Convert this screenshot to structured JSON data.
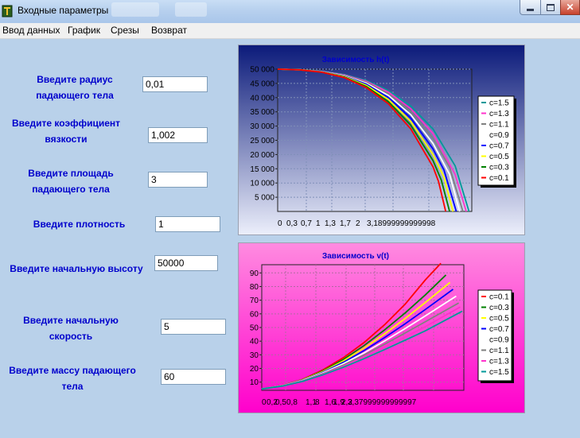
{
  "window": {
    "title": "Входные параметры"
  },
  "menu": {
    "items": [
      "Ввод данных",
      "График",
      "Срезы",
      "Возврат"
    ]
  },
  "form": {
    "radius_label": "Введите радиус падающего тела",
    "radius_value": "0,01",
    "viscosity_label": "Введите коэффициент вязкости",
    "viscosity_value": "1,002",
    "area_label": "Введите площадь падающего тела",
    "area_value": "3",
    "density_label": "Введите плотность",
    "density_value": "1",
    "height_label": "Введите начальную высоту",
    "height_value": "50000",
    "speed_label": "Введите начальную скорость",
    "speed_value": "5",
    "mass_label": "Введите массу падающего тела",
    "mass_value": "60"
  },
  "colors": {
    "window_bg": "#b9d1ea",
    "label_text": "#0000cc",
    "chart1_top": "#0b1a7a",
    "chart2_bg": "#ff33cc"
  },
  "chart_data": [
    {
      "type": "line",
      "title": "Зависимость h(t)",
      "x_tick_labels": [
        "0",
        "0,3",
        "0,7",
        "1",
        "1,3",
        "1,7",
        "2",
        "3,18999999999998"
      ],
      "y_ticks": [
        5000,
        10000,
        15000,
        20000,
        25000,
        30000,
        35000,
        40000,
        45000,
        50000
      ],
      "y_tick_labels": [
        "5 000",
        "10 000",
        "15 000",
        "20 000",
        "25 000",
        "30 000",
        "35 000",
        "40 000",
        "45 000",
        "50 000"
      ],
      "ylim": [
        0,
        50000
      ],
      "grid": true,
      "legend_position": "right",
      "series": [
        {
          "name": "c=1.5",
          "color": "#009999",
          "x": [
            0,
            0.4,
            0.8,
            1.2,
            1.6,
            2.0,
            2.4,
            2.8,
            3.2,
            3.45
          ],
          "y": [
            50000,
            49820,
            49250,
            48100,
            46000,
            42400,
            37000,
            29000,
            16000,
            0
          ]
        },
        {
          "name": "c=1.3",
          "color": "#ff33cc",
          "x": [
            0,
            0.4,
            0.8,
            1.2,
            1.6,
            2.0,
            2.4,
            2.8,
            3.2,
            3.4
          ],
          "y": [
            50000,
            49810,
            49200,
            48000,
            45700,
            41900,
            36100,
            27400,
            13000,
            0
          ]
        },
        {
          "name": "c=1.1",
          "color": "#808080",
          "x": [
            0,
            0.4,
            0.8,
            1.2,
            1.6,
            2.0,
            2.4,
            2.8,
            3.1,
            3.34
          ],
          "y": [
            50000,
            49800,
            49150,
            47850,
            45400,
            41300,
            35100,
            25700,
            15500,
            0
          ]
        },
        {
          "name": "c=0.9",
          "color": "#ffffff",
          "x": [
            0,
            0.4,
            0.8,
            1.2,
            1.6,
            2.0,
            2.4,
            2.8,
            3.1,
            3.28
          ],
          "y": [
            50000,
            49790,
            49100,
            47700,
            45050,
            40700,
            34000,
            23900,
            13000,
            0
          ]
        },
        {
          "name": "c=0.7",
          "color": "#0000ff",
          "x": [
            0,
            0.4,
            0.8,
            1.2,
            1.6,
            2.0,
            2.4,
            2.8,
            3.0,
            3.22
          ],
          "y": [
            50000,
            49780,
            49050,
            47550,
            44700,
            40000,
            32800,
            22000,
            14500,
            0
          ]
        },
        {
          "name": "c=0.5",
          "color": "#ffff00",
          "x": [
            0,
            0.4,
            0.8,
            1.2,
            1.6,
            2.0,
            2.4,
            2.8,
            3.0,
            3.16
          ],
          "y": [
            50000,
            49770,
            49000,
            47400,
            44300,
            39300,
            31600,
            20000,
            12000,
            0
          ]
        },
        {
          "name": "c=0.3",
          "color": "#008000",
          "x": [
            0,
            0.4,
            0.8,
            1.2,
            1.6,
            2.0,
            2.4,
            2.8,
            2.95,
            3.1
          ],
          "y": [
            50000,
            49760,
            48950,
            47200,
            43900,
            38500,
            30300,
            17900,
            11000,
            0
          ]
        },
        {
          "name": "c=0.1",
          "color": "#ff0000",
          "x": [
            0,
            0.4,
            0.8,
            1.2,
            1.6,
            2.0,
            2.4,
            2.8,
            2.9,
            3.03
          ],
          "y": [
            50000,
            49750,
            48900,
            47050,
            43500,
            37800,
            29000,
            15700,
            10500,
            0
          ]
        }
      ]
    },
    {
      "type": "line",
      "title": "Зависимость v(t)",
      "x_tick_labels": [
        "0",
        "0,2",
        "0,5",
        "0,8",
        "1,1",
        "8",
        "1,6",
        "1,9",
        "2,2",
        "3,37999999999997"
      ],
      "y_ticks": [
        10,
        20,
        30,
        40,
        50,
        60,
        70,
        80,
        90
      ],
      "y_tick_labels": [
        "10",
        "20",
        "30",
        "40",
        "50",
        "60",
        "70",
        "80",
        "90"
      ],
      "ylim": [
        4,
        96
      ],
      "grid": true,
      "legend_position": "right",
      "series": [
        {
          "name": "c=0.1",
          "color": "#ff0000",
          "x": [
            0,
            0.4,
            0.8,
            1.2,
            1.6,
            2.0,
            2.4,
            2.8,
            3.2,
            3.5
          ],
          "y": [
            5,
            7.5,
            12,
            19,
            28,
            39,
            52,
            67,
            85,
            97
          ]
        },
        {
          "name": "c=0.3",
          "color": "#008000",
          "x": [
            0,
            0.4,
            0.8,
            1.2,
            1.6,
            2.0,
            2.4,
            2.8,
            3.2,
            3.6
          ],
          "y": [
            5,
            7.4,
            11.8,
            18.3,
            26.7,
            36.8,
            48.2,
            60.6,
            74,
            88.5
          ]
        },
        {
          "name": "c=0.5",
          "color": "#ffff00",
          "x": [
            0,
            0.4,
            0.8,
            1.2,
            1.6,
            2.0,
            2.4,
            2.8,
            3.2,
            3.68
          ],
          "y": [
            5,
            7.4,
            11.6,
            17.8,
            25.6,
            34.9,
            45.3,
            56.5,
            68.4,
            83
          ]
        },
        {
          "name": "c=0.7",
          "color": "#0000ff",
          "x": [
            0,
            0.4,
            0.8,
            1.2,
            1.6,
            2.0,
            2.4,
            2.8,
            3.2,
            3.74
          ],
          "y": [
            5,
            7.3,
            11.4,
            17.3,
            24.6,
            33.1,
            42.6,
            52.7,
            63.3,
            78
          ]
        },
        {
          "name": "c=0.9",
          "color": "#ffffff",
          "x": [
            0,
            0.4,
            0.8,
            1.2,
            1.6,
            2.0,
            2.4,
            2.8,
            3.2,
            3.8
          ],
          "y": [
            5,
            7.3,
            11.2,
            16.8,
            23.6,
            31.4,
            40.1,
            49.2,
            58.6,
            73
          ]
        },
        {
          "name": "c=1.1",
          "color": "#808080",
          "x": [
            0,
            0.4,
            0.8,
            1.2,
            1.6,
            2.0,
            2.4,
            2.8,
            3.2,
            3.85
          ],
          "y": [
            5,
            7.2,
            11,
            16.3,
            22.6,
            29.8,
            37.7,
            45.9,
            54.3,
            68
          ]
        },
        {
          "name": "c=1.3",
          "color": "#ff33cc",
          "x": [
            0,
            0.4,
            0.8,
            1.2,
            1.6,
            2.0,
            2.4,
            2.8,
            3.2,
            3.88
          ],
          "y": [
            5,
            7.2,
            10.8,
            15.9,
            21.8,
            28.4,
            35.6,
            43.1,
            50.7,
            65
          ]
        },
        {
          "name": "c=1.5",
          "color": "#009999",
          "x": [
            0,
            0.4,
            0.8,
            1.2,
            1.6,
            2.0,
            2.4,
            2.8,
            3.2,
            3.92
          ],
          "y": [
            5,
            7.1,
            10.6,
            15.4,
            21,
            27.2,
            33.8,
            40.7,
            47.6,
            62
          ]
        }
      ]
    }
  ]
}
